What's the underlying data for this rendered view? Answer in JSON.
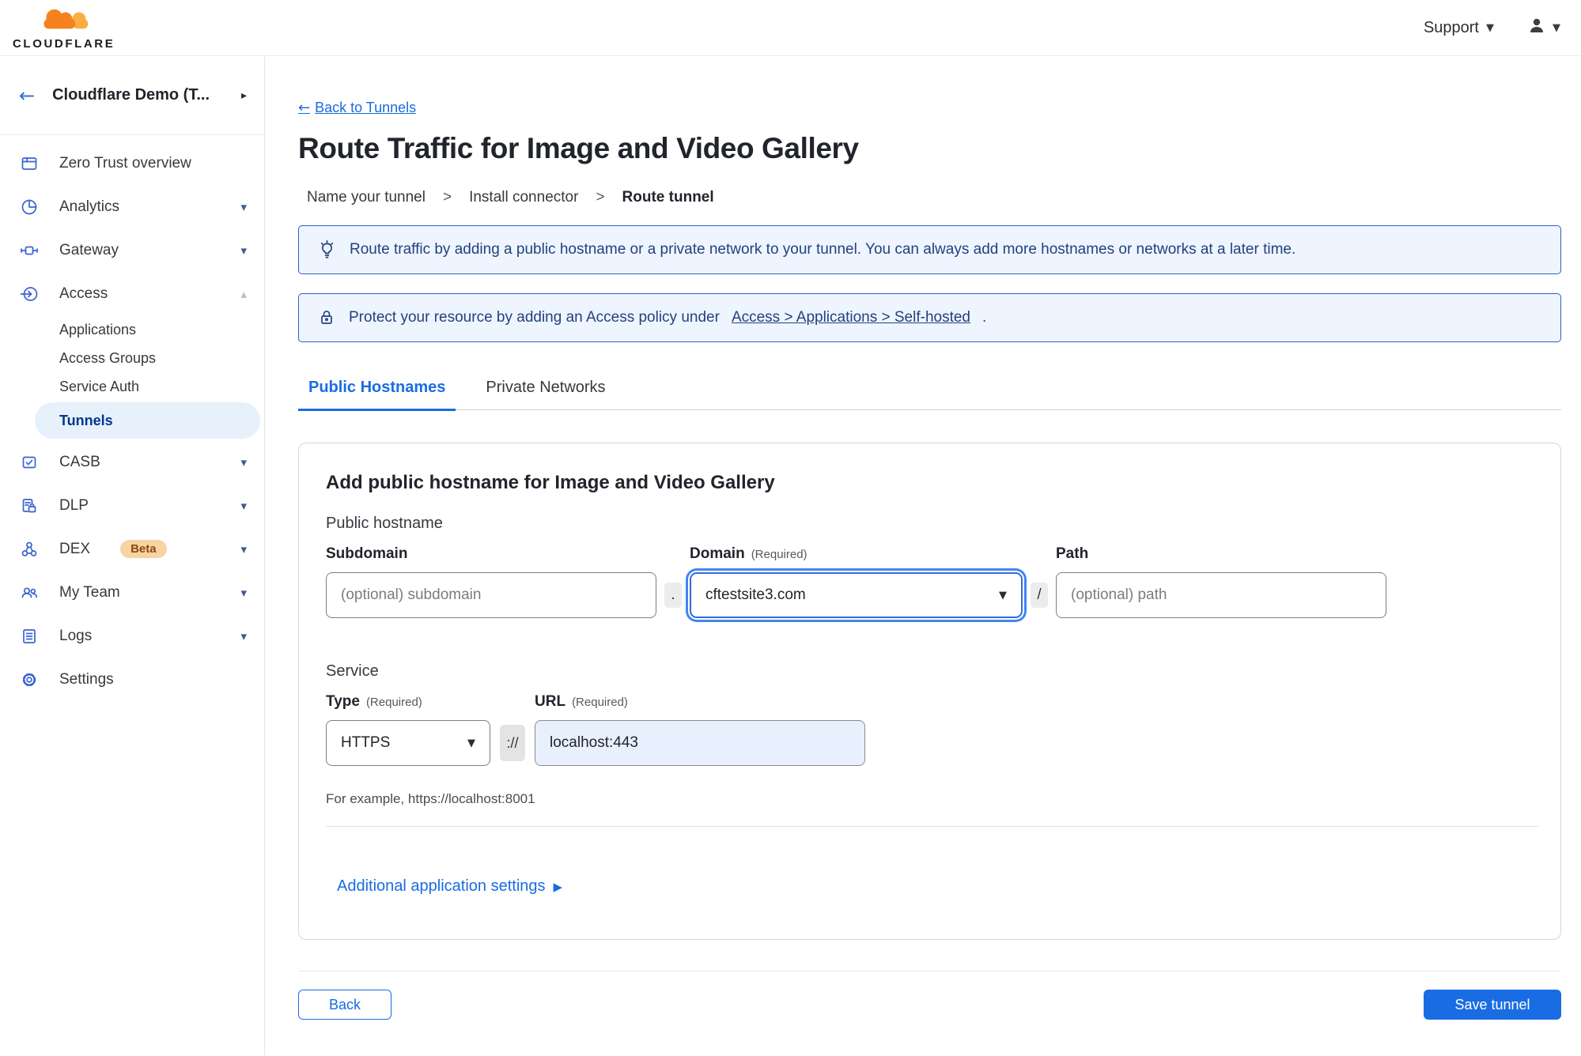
{
  "colors": {
    "accent_blue": "#1a6ce2",
    "save_button_bg": "#1a6ce2",
    "banner_bg": "#eef5ff",
    "banner_border": "#3060c0",
    "banner_text": "#24407e",
    "active_nav_bg": "#e7f1fc",
    "active_nav_text": "#00368d",
    "url_field_bg": "#e8f0fd",
    "beta_badge_bg": "#f8d3a4",
    "logo_orange": "#f6821f",
    "logo_orange_light": "#fbad41"
  },
  "icons": {
    "back_arrow": "←",
    "collapse_chevron": "▸",
    "nav_caret_down": "▾",
    "nav_caret_up": "▴",
    "select_caret": "▼",
    "support_caret": "▼",
    "expand_arrow": "▶",
    "breadcrumb_separator": ">"
  },
  "topbar": {
    "brand": "CLOUDFLARE",
    "support_label": "Support"
  },
  "sidebar": {
    "account_name": "Cloudflare Demo (T...",
    "items": [
      {
        "label": "Zero Trust overview",
        "icon": "overview-icon"
      },
      {
        "label": "Analytics",
        "icon": "analytics-icon",
        "caret": "down"
      },
      {
        "label": "Gateway",
        "icon": "gateway-icon",
        "caret": "down"
      },
      {
        "label": "Access",
        "icon": "access-icon",
        "caret": "up",
        "expanded": true
      },
      {
        "label": "Applications",
        "sub": true
      },
      {
        "label": "Access Groups",
        "sub": true
      },
      {
        "label": "Service Auth",
        "sub": true
      },
      {
        "label": "Tunnels",
        "sub": true,
        "active": true
      },
      {
        "label": "CASB",
        "icon": "casb-icon",
        "caret": "down"
      },
      {
        "label": "DLP",
        "icon": "dlp-icon",
        "caret": "down"
      },
      {
        "label": "DEX",
        "icon": "dex-icon",
        "badge": "Beta",
        "caret": "down"
      },
      {
        "label": "My Team",
        "icon": "team-icon",
        "caret": "down"
      },
      {
        "label": "Logs",
        "icon": "logs-icon",
        "caret": "down"
      },
      {
        "label": "Settings",
        "icon": "settings-icon"
      }
    ]
  },
  "main": {
    "back_link": "Back to Tunnels",
    "title": "Route Traffic for Image and Video Gallery",
    "steps": [
      "Name your tunnel",
      "Install connector",
      "Route tunnel"
    ],
    "banners": [
      {
        "icon": "lightbulb-icon",
        "text": "Route traffic by adding a public hostname or a private network to your tunnel. You can always add more hostnames or networks at a later time."
      },
      {
        "icon": "lock-icon",
        "text_prefix": "Protect your resource by adding an Access policy under",
        "link_text": "Access > Applications > Self-hosted",
        "text_suffix": "."
      }
    ],
    "tabs": [
      {
        "label": "Public Hostnames",
        "active": true
      },
      {
        "label": "Private Networks",
        "active": false
      }
    ],
    "card": {
      "heading": "Add public hostname for Image and Video Gallery",
      "section_public_hostname": "Public hostname",
      "subdomain_label": "Subdomain",
      "subdomain_placeholder": "(optional) subdomain",
      "dot_separator": ".",
      "domain_label": "Domain",
      "domain_required": "(Required)",
      "domain_value": "cftestsite3.com",
      "slash_separator": "/",
      "path_label": "Path",
      "path_placeholder": "(optional) path",
      "section_service": "Service",
      "type_label": "Type",
      "type_required": "(Required)",
      "type_value": "HTTPS",
      "scheme_separator": "://",
      "url_label": "URL",
      "url_required": "(Required)",
      "url_value": "localhost:443",
      "example_text": "For example, https://localhost:8001",
      "additional_settings_label": "Additional application settings"
    },
    "footer": {
      "back_label": "Back",
      "save_label": "Save tunnel"
    }
  }
}
